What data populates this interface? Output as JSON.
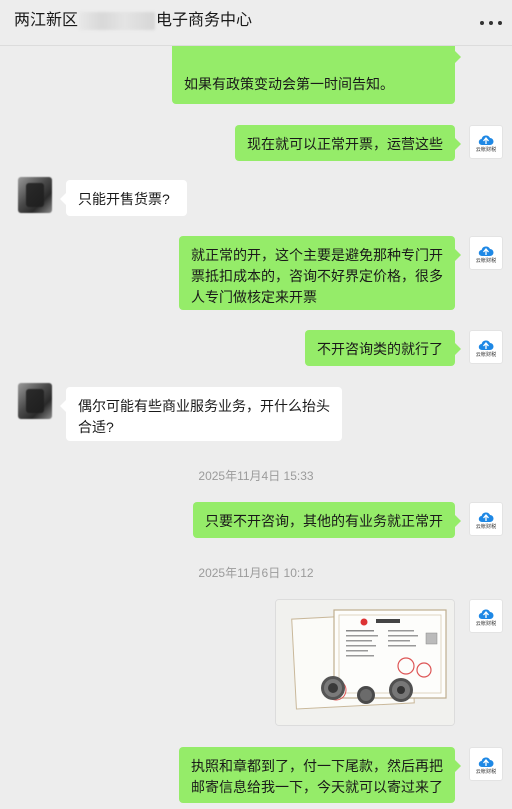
{
  "header": {
    "title_prefix": "两江新区",
    "title_suffix": "电子商务中心",
    "more_icon": "more-dots-icon"
  },
  "contact_avatar": {
    "text": "云帐财税"
  },
  "messages": [
    {
      "side": "out",
      "text": "如果有政策变动会第一时间告知。"
    },
    {
      "side": "out",
      "text": "现在就可以正常开票，运营这些"
    },
    {
      "side": "in",
      "text": "只能开售货票?"
    },
    {
      "side": "out",
      "text": "就正常的开，这个主要是避免那种专门开票抵扣成本的，咨询不好界定价格，很多人专门做核定来开票"
    },
    {
      "side": "out",
      "text": "不开咨询类的就行了"
    },
    {
      "side": "in",
      "text": "偶尔可能有些商业服务业务，开什么抬头合适?"
    },
    {
      "side": "time",
      "text": "2025年11月4日 15:33"
    },
    {
      "side": "out",
      "text": "只要不开咨询，其他的有业务就正常开"
    },
    {
      "side": "time",
      "text": "2025年11月6日 10:12"
    },
    {
      "side": "out",
      "type": "image",
      "caption": "营业执照"
    },
    {
      "side": "out",
      "text": "执照和章都到了，付一下尾款，然后再把邮寄信息给我一下，今天就可以寄过来了"
    }
  ],
  "colors": {
    "out_bubble": "#95ec69",
    "in_bubble": "#ffffff",
    "background": "#ededed",
    "brand_blue": "#1e88e5"
  }
}
